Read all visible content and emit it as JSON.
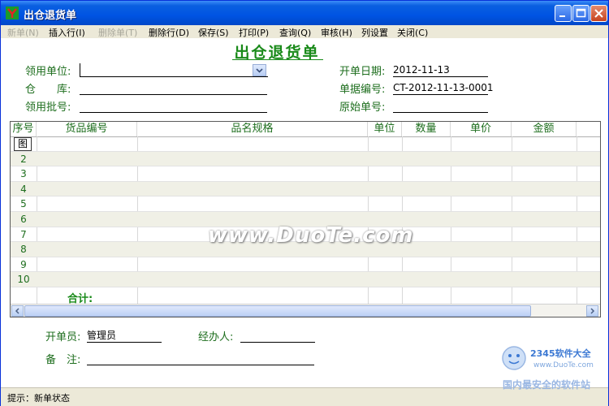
{
  "window": {
    "title": "出仓退货单"
  },
  "menu": {
    "items": [
      {
        "label": "新单(N)",
        "disabled": true
      },
      {
        "label": "插入行(I)",
        "disabled": false
      },
      {
        "label": "删除单(T)",
        "disabled": true
      },
      {
        "label": "删除行(D)",
        "disabled": false
      },
      {
        "label": "保存(S)",
        "disabled": false
      },
      {
        "label": "打印(P)",
        "disabled": false
      },
      {
        "label": "查询(Q)",
        "disabled": false
      },
      {
        "label": "审核(H)",
        "disabled": false
      },
      {
        "label": "列设置",
        "disabled": false
      },
      {
        "label": "关闭(C)",
        "disabled": false
      }
    ]
  },
  "form": {
    "title": "出仓退货单",
    "fields": {
      "dept_label": "领用单位:",
      "dept_value": "",
      "warehouse_label": "仓　　库:",
      "warehouse_value": "",
      "batch_label": "领用批号:",
      "batch_value": "",
      "date_label": "开单日期:",
      "date_value": "2012-11-13",
      "doc_no_label": "单据编号:",
      "doc_no_value": "CT-2012-11-13-0001",
      "orig_no_label": "原始单号:",
      "orig_no_value": ""
    }
  },
  "grid": {
    "columns": [
      "序号",
      "货品编号",
      "品名规格",
      "单位",
      "数量",
      "单价",
      "金额"
    ],
    "first_row_marker": "图",
    "rows": [
      "2",
      "3",
      "4",
      "5",
      "6",
      "7",
      "8",
      "9",
      "10"
    ],
    "total_label": "合计:"
  },
  "footer": {
    "issuer_label": "开单员:",
    "issuer_value": "管理员",
    "handler_label": "经办人:",
    "handler_value": "",
    "remark_label": "备　注:",
    "remark_value": ""
  },
  "status": {
    "text": "提示：新单状态"
  },
  "watermark": {
    "text": "www.DuoTe.com"
  },
  "badge": {
    "title": "2345软件大全",
    "sub": "www.DuoTe.com",
    "bottom": "国内最安全的软件站"
  }
}
